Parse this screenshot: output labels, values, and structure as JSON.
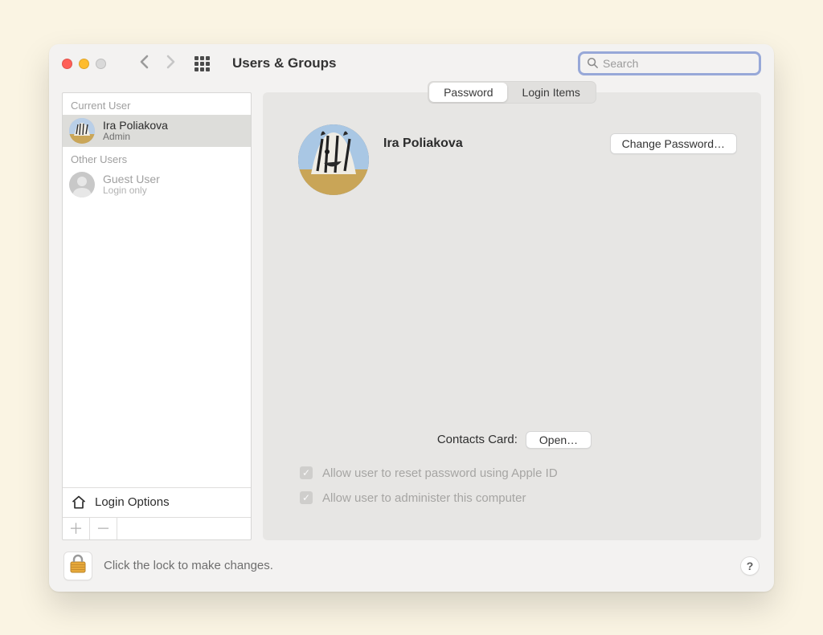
{
  "header": {
    "title": "Users & Groups",
    "search_placeholder": "Search"
  },
  "sidebar": {
    "current_label": "Current User",
    "other_label": "Other Users",
    "current_user": {
      "name": "Ira Poliakova",
      "role": "Admin"
    },
    "guest_user": {
      "name": "Guest User",
      "role": "Login only"
    },
    "login_options_label": "Login Options"
  },
  "main": {
    "tabs": {
      "password": "Password",
      "login_items": "Login Items"
    },
    "profile_name": "Ira Poliakova",
    "change_password_label": "Change Password…",
    "contacts_label": "Contacts Card:",
    "open_label": "Open…",
    "allow_reset_label": "Allow user to reset password using Apple ID",
    "allow_admin_label": "Allow user to administer this computer"
  },
  "footer": {
    "lock_text": "Click the lock to make changes.",
    "help_label": "?"
  }
}
